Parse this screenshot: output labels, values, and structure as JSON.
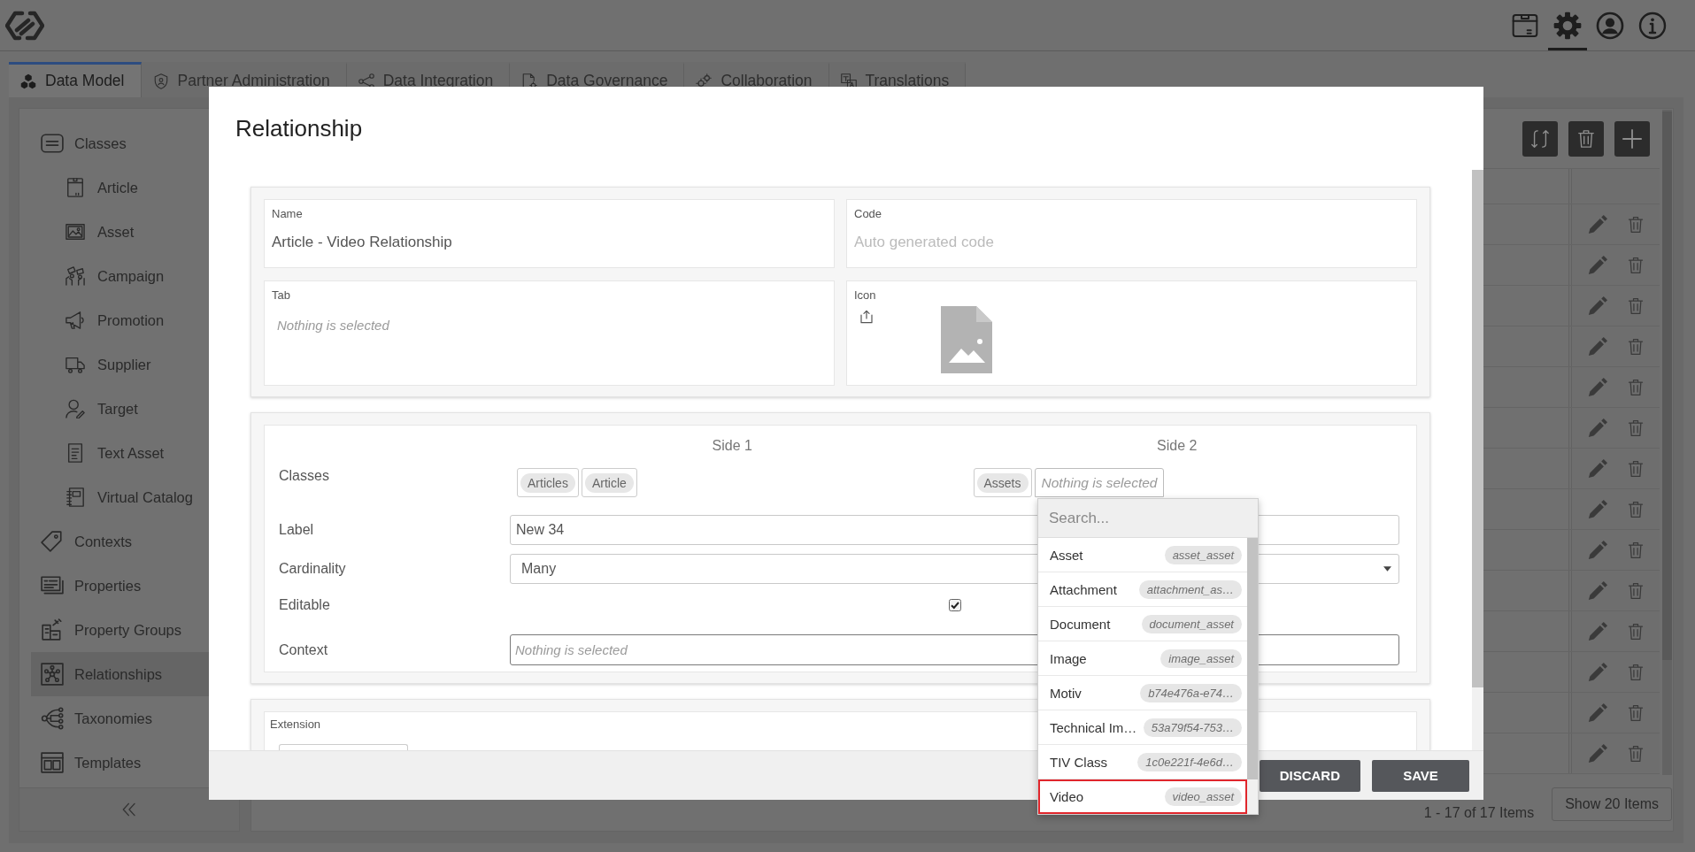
{
  "header": {
    "icons": [
      {
        "kind": "package",
        "selected": false
      },
      {
        "kind": "settings",
        "selected": true
      },
      {
        "kind": "user",
        "selected": false
      },
      {
        "kind": "info",
        "selected": false
      }
    ]
  },
  "tabs": [
    {
      "label": "Data Model",
      "kind": "model",
      "selected": true
    },
    {
      "label": "Partner Administration",
      "kind": "partner",
      "selected": false
    },
    {
      "label": "Data Integration",
      "kind": "integration",
      "selected": false
    },
    {
      "label": "Data Governance",
      "kind": "governance",
      "selected": false
    },
    {
      "label": "Collaboration",
      "kind": "collaboration",
      "selected": false
    },
    {
      "label": "Translations",
      "kind": "translations",
      "selected": false
    }
  ],
  "sidebar": {
    "items": [
      {
        "label": "Classes",
        "kind": "classes",
        "selected": false,
        "children": [
          {
            "label": "Article",
            "kind": "article",
            "selected": false
          },
          {
            "label": "Asset",
            "kind": "asset",
            "selected": false
          },
          {
            "label": "Campaign",
            "kind": "campaign",
            "selected": false
          },
          {
            "label": "Promotion",
            "kind": "promotion",
            "selected": false
          },
          {
            "label": "Supplier",
            "kind": "supplier",
            "selected": false
          },
          {
            "label": "Target",
            "kind": "target",
            "selected": false
          },
          {
            "label": "Text Asset",
            "kind": "text",
            "selected": false
          },
          {
            "label": "Virtual Catalog",
            "kind": "catalog",
            "selected": false
          }
        ]
      },
      {
        "label": "Contexts",
        "kind": "contexts",
        "selected": false
      },
      {
        "label": "Properties",
        "kind": "properties",
        "selected": false
      },
      {
        "label": "Property Groups",
        "kind": "groups",
        "selected": false
      },
      {
        "label": "Relationships",
        "kind": "relationships",
        "selected": true
      },
      {
        "label": "Taxonomies",
        "kind": "taxonomies",
        "selected": false
      },
      {
        "label": "Templates",
        "kind": "templates",
        "selected": false
      }
    ]
  },
  "table": {
    "summary": "1 - 17 of 17 Items",
    "page_size_button": "Show 20 Items"
  },
  "dialog": {
    "title": "Relationship",
    "general": {
      "name": {
        "label": "Name",
        "value": "Article - Video Relationship"
      },
      "code": {
        "label": "Code",
        "placeholder": "Auto generated code"
      },
      "tab": {
        "label": "Tab",
        "placeholder": "Nothing is selected"
      },
      "icon": {
        "label": "Icon"
      }
    },
    "relationship": {
      "side_headers": [
        "Side 1",
        "Side 2"
      ],
      "classes": {
        "label": "Classes",
        "side_1": {
          "groups": [
            "Articles"
          ],
          "value": "Article"
        },
        "side_2": {
          "groups": [
            "Assets"
          ],
          "placeholder": "Nothing is selected",
          "expanded": true,
          "search_placeholder": "Search...",
          "options": [
            {
              "label": "Asset",
              "code": "asset_asset",
              "selected": false
            },
            {
              "label": "Attachment",
              "code": "attachment_as…",
              "selected": false
            },
            {
              "label": "Document",
              "code": "document_asset",
              "selected": false
            },
            {
              "label": "Image",
              "code": "image_asset",
              "selected": false
            },
            {
              "label": "Motiv",
              "code": "b74e476a-e74…",
              "selected": false
            },
            {
              "label": "Technical Im…",
              "code": "53a79f54-753…",
              "selected": false
            },
            {
              "label": "TIV Class",
              "code": "1c0e221f-4e6d…",
              "selected": false
            },
            {
              "label": "Video",
              "code": "video_asset",
              "selected": true
            }
          ]
        }
      },
      "label": {
        "label": "Label",
        "value": "New 34"
      },
      "cardinality": {
        "label": "Cardinality",
        "value": "Many"
      },
      "editable": {
        "label": "Editable",
        "checked": true
      },
      "context": {
        "label": "Context",
        "placeholder": "Nothing is selected"
      }
    },
    "extension": {
      "label": "Extension"
    },
    "buttons": [
      "DISCARD",
      "SAVE"
    ]
  }
}
